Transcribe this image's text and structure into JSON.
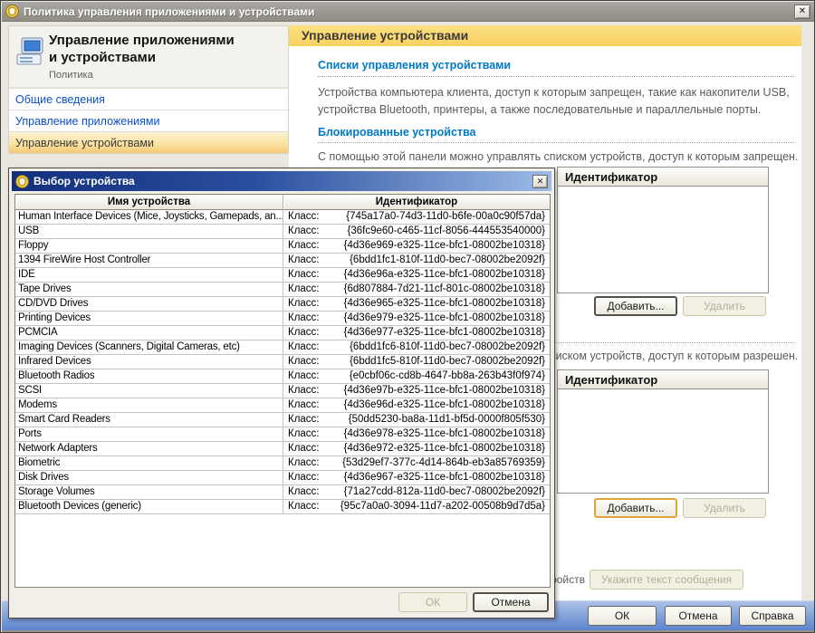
{
  "window": {
    "title": "Политика управления приложениями и устройствами"
  },
  "icons": {
    "close_glyph": "✕"
  },
  "sidebar": {
    "title": "Управление приложениями\nи устройствами",
    "subtitle": "Политика",
    "items": [
      {
        "label": "Общие сведения",
        "active": false
      },
      {
        "label": "Управление приложениями",
        "active": false
      },
      {
        "label": "Управление устройствами",
        "active": true
      }
    ]
  },
  "content": {
    "header": "Управление устройствами",
    "section1": {
      "heading": "Списки управления устройствами",
      "text": "Устройства компьютера клиента, доступ к которым запрещен, такие как накопители USB,\nустройства Bluetooth, принтеры, а также последовательные и параллельные порты."
    },
    "section2": {
      "heading": "Блокированные устройства",
      "text": "С помощью этой панели можно управлять списком устройств, доступ к которым запрещен."
    },
    "blocked_panel": {
      "column_header": "Идентификатор",
      "add_label": "Добавить...",
      "remove_label": "Удалить"
    },
    "allowed_text": "С помощью этой панели можно управлять списком устройств, доступ к которым разрешен.",
    "allowed_panel": {
      "column_header": "Идентификатор",
      "add_label": "Добавить...",
      "remove_label": "Удалить"
    },
    "message_label": "устройств",
    "message_button": "Укажите текст сообщения"
  },
  "footer": {
    "ok": "ОК",
    "cancel": "Отмена",
    "help": "Справка"
  },
  "dialog": {
    "title": "Выбор устройства",
    "table": {
      "columns": [
        "Имя устройства",
        "Идентификатор"
      ],
      "class_label": "Класс:",
      "rows": [
        {
          "name": "Human Interface Devices (Mice, Joysticks, Gamepads, an...",
          "guid": "{745a17a0-74d3-11d0-b6fe-00a0c90f57da}"
        },
        {
          "name": "USB",
          "guid": "{36fc9e60-c465-11cf-8056-444553540000}"
        },
        {
          "name": "Floppy",
          "guid": "{4d36e969-e325-11ce-bfc1-08002be10318}"
        },
        {
          "name": "1394 FireWire Host Controller",
          "guid": "{6bdd1fc1-810f-11d0-bec7-08002be2092f}"
        },
        {
          "name": "IDE",
          "guid": "{4d36e96a-e325-11ce-bfc1-08002be10318}"
        },
        {
          "name": "Tape Drives",
          "guid": "{6d807884-7d21-11cf-801c-08002be10318}"
        },
        {
          "name": "CD/DVD Drives",
          "guid": "{4d36e965-e325-11ce-bfc1-08002be10318}"
        },
        {
          "name": "Printing Devices",
          "guid": "{4d36e979-e325-11ce-bfc1-08002be10318}"
        },
        {
          "name": "PCMCIA",
          "guid": "{4d36e977-e325-11ce-bfc1-08002be10318}"
        },
        {
          "name": "Imaging Devices (Scanners, Digital Cameras, etc)",
          "guid": "{6bdd1fc6-810f-11d0-bec7-08002be2092f}"
        },
        {
          "name": "Infrared Devices",
          "guid": "{6bdd1fc5-810f-11d0-bec7-08002be2092f}"
        },
        {
          "name": "Bluetooth Radios",
          "guid": "{e0cbf06c-cd8b-4647-bb8a-263b43f0f974}"
        },
        {
          "name": "SCSI",
          "guid": "{4d36e97b-e325-11ce-bfc1-08002be10318}"
        },
        {
          "name": "Modems",
          "guid": "{4d36e96d-e325-11ce-bfc1-08002be10318}"
        },
        {
          "name": "Smart Card Readers",
          "guid": "{50dd5230-ba8a-11d1-bf5d-0000f805f530}"
        },
        {
          "name": "Ports",
          "guid": "{4d36e978-e325-11ce-bfc1-08002be10318}"
        },
        {
          "name": "Network Adapters",
          "guid": "{4d36e972-e325-11ce-bfc1-08002be10318}"
        },
        {
          "name": "Biometric",
          "guid": "{53d29ef7-377c-4d14-864b-eb3a85769359}"
        },
        {
          "name": "Disk Drives",
          "guid": "{4d36e967-e325-11ce-bfc1-08002be10318}"
        },
        {
          "name": "Storage Volumes",
          "guid": "{71a27cdd-812a-11d0-bec7-08002be2092f}"
        },
        {
          "name": "Bluetooth Devices (generic)",
          "guid": "{95c7a0a0-3094-11d7-a202-00508b9d7d5a}"
        }
      ]
    },
    "ok": "ОК",
    "cancel": "Отмена"
  },
  "colors": {
    "accent_gold": "#fbd76d",
    "dialog_titlebar_left": "#122f7b",
    "dialog_titlebar_right": "#9cbbe8",
    "inactive_titlebar": "#99978f",
    "heading_blue": "#0079c6",
    "selection_gradient": "#f6c876",
    "footer_band_blue": "#5d84ce"
  }
}
